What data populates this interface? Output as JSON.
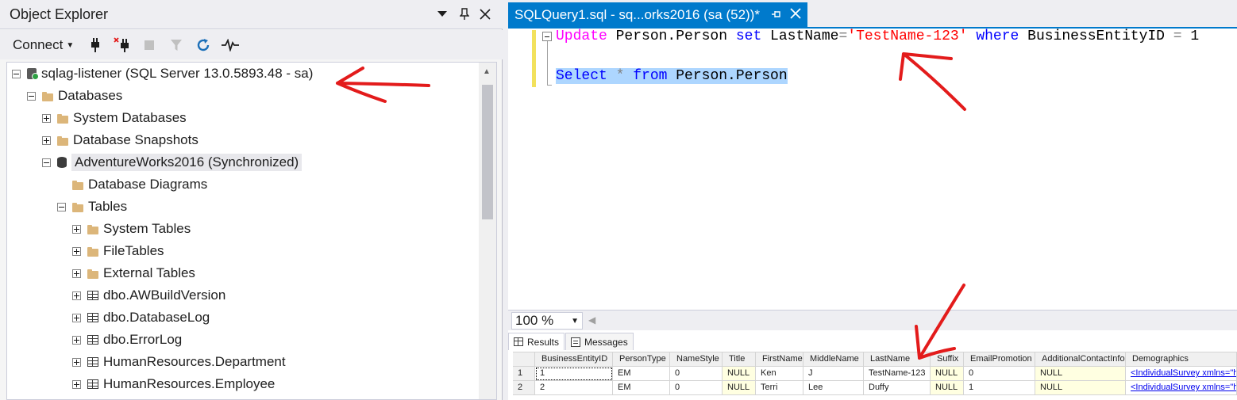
{
  "object_explorer": {
    "title": "Object Explorer",
    "connect_label": "Connect",
    "tree": [
      {
        "label": "sqlag-listener (SQL Server 13.0.5893.48 - sa)",
        "type": "server",
        "level": 0,
        "expander": "minus"
      },
      {
        "label": "Databases",
        "type": "folder",
        "level": 1,
        "expander": "minus"
      },
      {
        "label": "System Databases",
        "type": "folder",
        "level": 2,
        "expander": "plus"
      },
      {
        "label": "Database Snapshots",
        "type": "folder",
        "level": 2,
        "expander": "plus"
      },
      {
        "label": "AdventureWorks2016 (Synchronized)",
        "type": "database",
        "level": 2,
        "expander": "minus"
      },
      {
        "label": "Database Diagrams",
        "type": "folder",
        "level": 3,
        "expander": "none"
      },
      {
        "label": "Tables",
        "type": "folder",
        "level": 3,
        "expander": "minus"
      },
      {
        "label": "System Tables",
        "type": "folder",
        "level": 4,
        "expander": "plus"
      },
      {
        "label": "FileTables",
        "type": "folder",
        "level": 4,
        "expander": "plus"
      },
      {
        "label": "External Tables",
        "type": "folder",
        "level": 4,
        "expander": "plus"
      },
      {
        "label": "dbo.AWBuildVersion",
        "type": "table",
        "level": 4,
        "expander": "plus"
      },
      {
        "label": "dbo.DatabaseLog",
        "type": "table",
        "level": 4,
        "expander": "plus"
      },
      {
        "label": "dbo.ErrorLog",
        "type": "table",
        "level": 4,
        "expander": "plus"
      },
      {
        "label": "HumanResources.Department",
        "type": "table",
        "level": 4,
        "expander": "plus"
      },
      {
        "label": "HumanResources.Employee",
        "type": "table",
        "level": 4,
        "expander": "plus"
      }
    ]
  },
  "editor": {
    "tab_title": "SQLQuery1.sql - sq...orks2016 (sa (52))*",
    "line1": {
      "kw_update": "Update",
      "obj1": " Person.Person ",
      "kw_set": "set",
      "col": " LastName",
      "eq": "=",
      "str": "'TestName-123'",
      "sp": " ",
      "kw_where": "where",
      "cond": " BusinessEntityID ",
      "eq2": "=",
      "val": " 1"
    },
    "line2": {
      "kw_select": "Select",
      "star": " * ",
      "kw_from": "from",
      "obj": " Person.Person"
    },
    "zoom": "100 %"
  },
  "results": {
    "tab_results": "Results",
    "tab_messages": "Messages",
    "columns": [
      "BusinessEntityID",
      "PersonType",
      "NameStyle",
      "Title",
      "FirstName",
      "MiddleName",
      "LastName",
      "Suffix",
      "EmailPromotion",
      "AdditionalContactInfo",
      "Demographics"
    ],
    "rows": [
      {
        "num": "1",
        "cells": [
          "1",
          "EM",
          "0",
          "NULL",
          "Ken",
          "J",
          "TestName-123",
          "NULL",
          "0",
          "NULL",
          "<IndividualSurvey xmlns=\"ht"
        ]
      },
      {
        "num": "2",
        "cells": [
          "2",
          "EM",
          "0",
          "NULL",
          "Terri",
          "Lee",
          "Duffy",
          "NULL",
          "1",
          "NULL",
          "<IndividualSurvey xmlns=\"ht"
        ]
      }
    ]
  },
  "colors": {
    "tab_blue": "#007acc",
    "annotation_red": "#e31b1b",
    "keyword_blue": "#0000ff",
    "string_red": "#ff0000",
    "function_magenta": "#ff00ff"
  }
}
